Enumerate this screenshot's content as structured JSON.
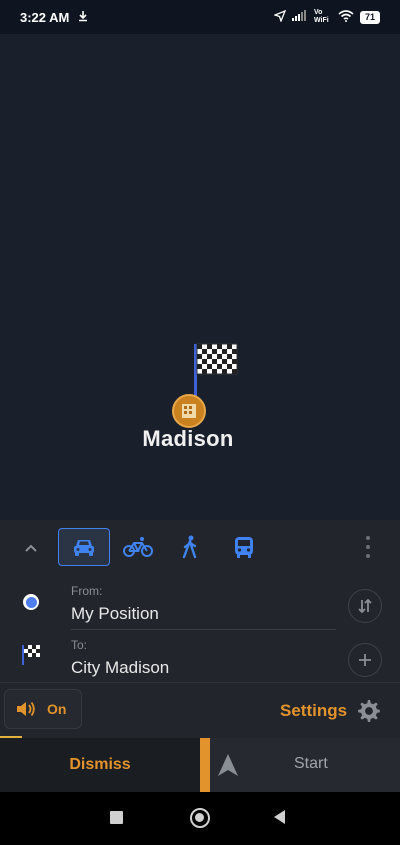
{
  "status_bar": {
    "time": "3:22 AM",
    "battery": "71",
    "network_label": "Vo WiFi"
  },
  "map": {
    "city_label": "Madison"
  },
  "route_panel": {
    "modes": [
      "car",
      "bicycle",
      "walking",
      "public-transport"
    ],
    "active_mode": "car",
    "from": {
      "label": "From:",
      "value": "My Position"
    },
    "to": {
      "label": "To:",
      "value": "City Madison"
    },
    "sound": {
      "label": "On"
    },
    "settings_label": "Settings"
  },
  "bottom_bar": {
    "dismiss_label": "Dismiss",
    "start_label": "Start"
  },
  "colors": {
    "accent": "#e3932b",
    "mode_active": "#3f82f0",
    "map_bg": "#1a1f2c",
    "panel_bg": "#22262c"
  }
}
